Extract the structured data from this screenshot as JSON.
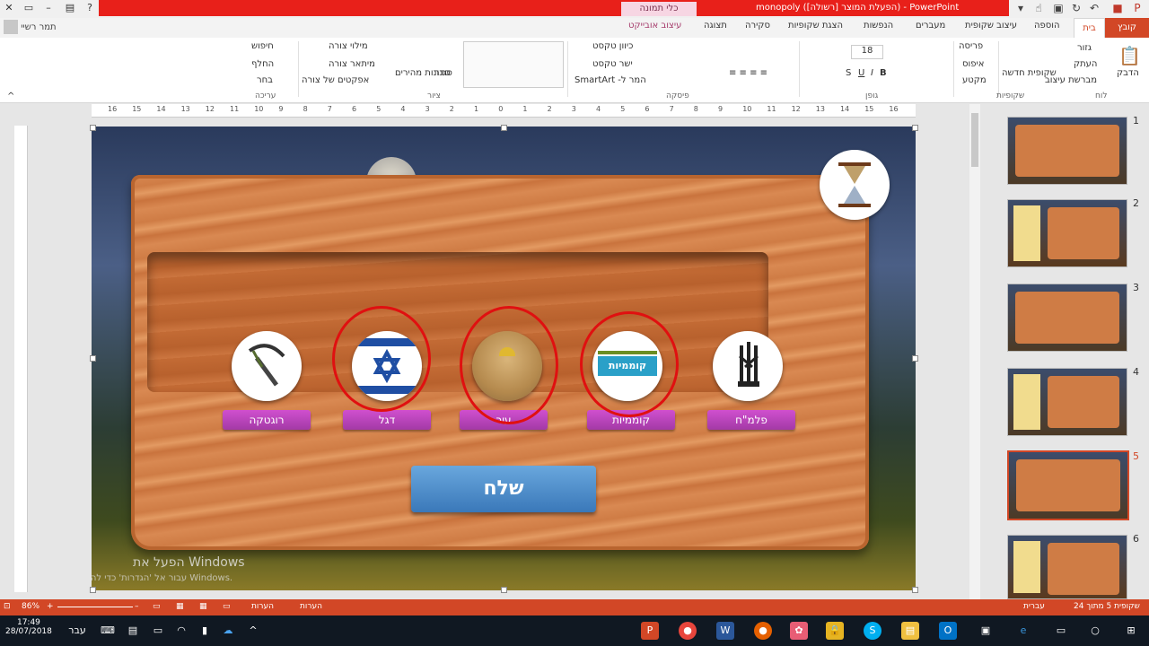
{
  "window": {
    "title": "monopoly (הפעלת המוצר [רשולה]) - PowerPoint",
    "contextual_tab": "כלי תמונה",
    "user_name": "תמר רשיי"
  },
  "ribbon_tabs": [
    "קובץ",
    "בית",
    "הוספה",
    "עיצוב שקופית",
    "מעברים",
    "הנפשות",
    "הצגת שקופיות",
    "סקירה",
    "תצוגה",
    "עיצוב אובייקט"
  ],
  "ribbon": {
    "clipboard": {
      "paste": "הדבק",
      "cut": "גזור",
      "copy": "העתק",
      "format_painter": "מברשת עיצוב",
      "label": "לוח"
    },
    "slides": {
      "new_slide": "שקופית חדשה",
      "layout": "פריסה",
      "reset": "איפוס",
      "section": "מקטע",
      "label": "שקופיות"
    },
    "font": {
      "size": "18",
      "label": "גופן"
    },
    "paragraph": {
      "text_direction": "כיוון טקסט",
      "align_text": "ישר טקסט",
      "smartart": "SmartArt -המר ל",
      "label": "פיסקה"
    },
    "drawing": {
      "arrange": "סדר",
      "quick_styles": "סגנונות מהירים",
      "shape_fill": "מילוי צורה",
      "shape_outline": "מיתאר צורה",
      "shape_effects": "אפקטים של צורה",
      "label": "ציור"
    },
    "editing": {
      "find": "חיפוש",
      "replace": "החלף",
      "select": "בחר",
      "label": "עריכה"
    }
  },
  "ruler_ticks": [
    "16",
    "15",
    "14",
    "13",
    "12",
    "11",
    "10",
    "9",
    "8",
    "7",
    "6",
    "5",
    "4",
    "3",
    "2",
    "1",
    "0",
    "1",
    "2",
    "3",
    "4",
    "5",
    "6",
    "7",
    "8",
    "9",
    "10",
    "11",
    "12",
    "13",
    "14",
    "15",
    "16"
  ],
  "slide": {
    "options": [
      {
        "label": "פלמ\"ח",
        "icon": "palmach-emblem-icon",
        "circled": false
      },
      {
        "label": "קוממיות",
        "icon": "komemiyut-logo-icon",
        "circled": true
      },
      {
        "label": "עיר",
        "icon": "jerusalem-photo-icon",
        "circled": true
      },
      {
        "label": "דגל",
        "icon": "israel-flag-icon",
        "circled": true
      },
      {
        "label": "רוגטקה",
        "icon": "slingshot-icon",
        "circled": false
      }
    ],
    "send_button": "שלח",
    "watermark_title": "הפעל את Windows",
    "watermark_sub": "עבור אל 'הגדרות' כדי להפעיל את Windows.",
    "colors": {
      "ring": "#e01010",
      "label": "#b743b8",
      "send": "#4a8bcb"
    }
  },
  "thumbnails": [
    {
      "num": "1"
    },
    {
      "num": "2"
    },
    {
      "num": "3"
    },
    {
      "num": "4"
    },
    {
      "num": "5",
      "active": true
    },
    {
      "num": "6"
    }
  ],
  "status": {
    "slide_info": "שקופית 5 מתוך 24",
    "language": "עברית",
    "notes": "הערות",
    "comments": "הערות",
    "zoom": "86%"
  },
  "taskbar": {
    "time": "17:49",
    "date": "28/07/2018",
    "lang": "עבר"
  }
}
